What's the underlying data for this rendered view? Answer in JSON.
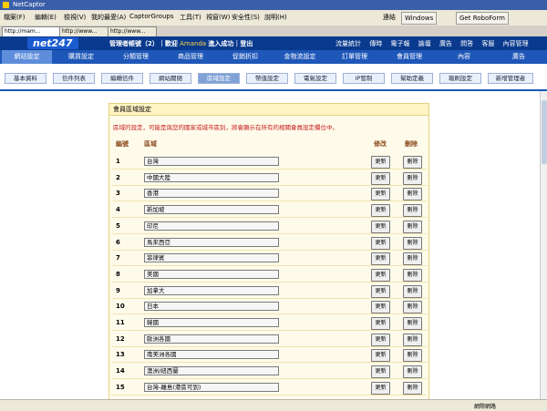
{
  "window": {
    "title": "NetCaptor"
  },
  "menubar": {
    "items": [
      "檔案(F)",
      "編輯(E)",
      "檢視(V)",
      "我的最愛(A)",
      "CaptorGroups",
      "工具(T)",
      "視窗(W)",
      "安全性(S)",
      "說明(H)"
    ],
    "address_label": "連結",
    "windows_label": "Windows",
    "roboform_label": "Get RoboForm"
  },
  "browser_tabs": [
    "http://mam...",
    "http://www...",
    "http://www..."
  ],
  "header": {
    "logo": "net247",
    "info_prefix": "管理者帳號（2）｜歡迎",
    "user": "Amanda",
    "info_suffix": "進入成功｜登出",
    "links": [
      "流量統計",
      "傳時",
      "電子報",
      "論壇",
      "廣告",
      "問答",
      "客服",
      "內容管理"
    ]
  },
  "nav": {
    "items": [
      "網站設定",
      "購買設定",
      "分類管理",
      "商品管理",
      "促銷折扣",
      "金物流設定",
      "訂單管理",
      "會員管理",
      "內容",
      "廣告"
    ],
    "active_index": 0
  },
  "subnav": {
    "items": [
      "基本資料",
      "信件列表",
      "編輯信件",
      "網站關閉",
      "區域設定",
      "幣值設定",
      "電氣設定",
      "IP管制",
      "幫助定義",
      "報刷設定",
      "新增管理者"
    ],
    "active_index": 4
  },
  "panel": {
    "title": "會員區域設定",
    "note": "區域的設定，可能是與您的國家或城市區別，將會顯示在所有的相關會員設定欄位中。",
    "col_no": "編號",
    "col_region": "區域",
    "col_update": "修改",
    "col_delete": "刪除",
    "update_label": "更新",
    "delete_label": "刪除",
    "rows": [
      {
        "no": "1",
        "region": "台灣"
      },
      {
        "no": "2",
        "region": "中國大陸"
      },
      {
        "no": "3",
        "region": "香港"
      },
      {
        "no": "4",
        "region": "新加坡"
      },
      {
        "no": "5",
        "region": "印尼"
      },
      {
        "no": "6",
        "region": "馬來西亞"
      },
      {
        "no": "7",
        "region": "菲律賓"
      },
      {
        "no": "8",
        "region": "美國"
      },
      {
        "no": "9",
        "region": "加拿大"
      },
      {
        "no": "10",
        "region": "日本"
      },
      {
        "no": "11",
        "region": "韓國"
      },
      {
        "no": "12",
        "region": "歐洲各國"
      },
      {
        "no": "13",
        "region": "南美洲各國"
      },
      {
        "no": "14",
        "region": "澳洲/紐西蘭"
      },
      {
        "no": "15",
        "region": "台灣-離島(港區可到)"
      }
    ]
  },
  "statusbar": {
    "zone": "網際網路"
  }
}
